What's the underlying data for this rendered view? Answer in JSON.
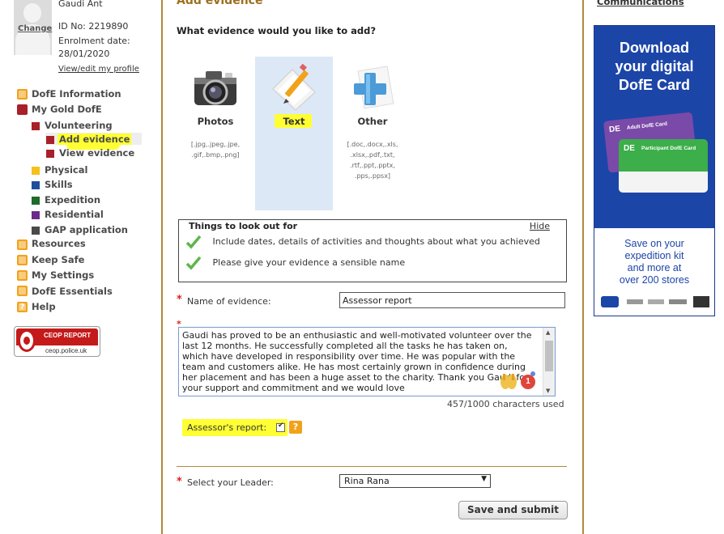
{
  "profile": {
    "name": "Gaudi Ant",
    "change_label": "Change",
    "id_line": "ID No: 2219890",
    "enrolment_label": "Enrolment date:",
    "enrolment_date": "28/01/2020",
    "view_edit_link": "View/edit my profile"
  },
  "nav": {
    "dofe_information": "DofE Information",
    "my_gold_dofe": "My Gold DofE",
    "volunteering": "Volunteering",
    "add_evidence": "Add evidence",
    "view_evidence": "View evidence",
    "physical": "Physical",
    "skills": "Skills",
    "expedition": "Expedition",
    "residential": "Residential",
    "gap_application": "GAP application",
    "resources": "Resources",
    "keep_safe": "Keep Safe",
    "my_settings": "My Settings",
    "dofe_essentials": "DofE Essentials",
    "help": "Help"
  },
  "ceop": {
    "title": "CEOP REPORT",
    "url": "ceop.police.uk"
  },
  "main": {
    "title": "Add evidence",
    "question": "What evidence would you like to add?",
    "evidence_types": [
      {
        "label": "Photos",
        "types": [
          ".jpg,.jpeg,.jpe,",
          ".gif,.bmp,.png]"
        ],
        "types_open": "[.jpg,.jpeg,.jpe,",
        "types_close": ".gif,.bmp,.png]"
      },
      {
        "label": "Text"
      },
      {
        "label": "Other",
        "types_open": "[.doc,.docx,.xls,",
        "types_mid1": ".xlsx,.pdf,.txt,",
        "types_mid2": ".rtf,.ppt,.pptx,",
        "types_close": ".pps,.ppsx]"
      }
    ],
    "tips": {
      "title": "Things to look out for",
      "hide": "Hide",
      "items": [
        "Include dates, details of activities and thoughts about what you achieved",
        "Please give your evidence a sensible name"
      ]
    },
    "name_label": "Name of evidence:",
    "name_value": "Assessor report",
    "required_mark": "*",
    "evidence_text": "Gaudi has proved to be an enthusiastic and well-motivated volunteer over the last 12 months. He successfully completed all the tasks he has taken on, which have developed in responsibility over time. He was popular with the team and customers alike. He has most certainly grown in confidence during her placement and has been a huge asset to the charity. Thank you Gaudi for your support and commitment and we would love",
    "grammar_count": "1",
    "char_count": "457/1000 characters used",
    "assessor_label": "Assessor's report:",
    "assessor_checked": true,
    "help_mark": "?",
    "leader_label": "Select your Leader:",
    "leader_value": "Rina Rana",
    "submit_label": "Save and submit"
  },
  "right": {
    "communications": "Communications",
    "ad": {
      "headline_1": "Download",
      "headline_2": "your digital",
      "headline_3": "DofE Card",
      "card_adult": "Adult DofE Card",
      "card_participant": "Participant DofE Card",
      "card_logo": "DE",
      "footer_1": "Save on your",
      "footer_2": "expedition kit",
      "footer_3": "and more at",
      "footer_4": "over 200 stores"
    }
  },
  "colors": {
    "accent_brown": "#9c6f1e",
    "highlight_yellow": "#ffff33",
    "ad_blue": "#1c45a8",
    "volunteering_red": "#a8202a",
    "physical_yellow": "#f5c11a",
    "skills_blue": "#1e4e9c",
    "expedition_green": "#1e6b2a",
    "residential_purple": "#6b2a8a",
    "gap_grey": "#4a4a4a"
  }
}
